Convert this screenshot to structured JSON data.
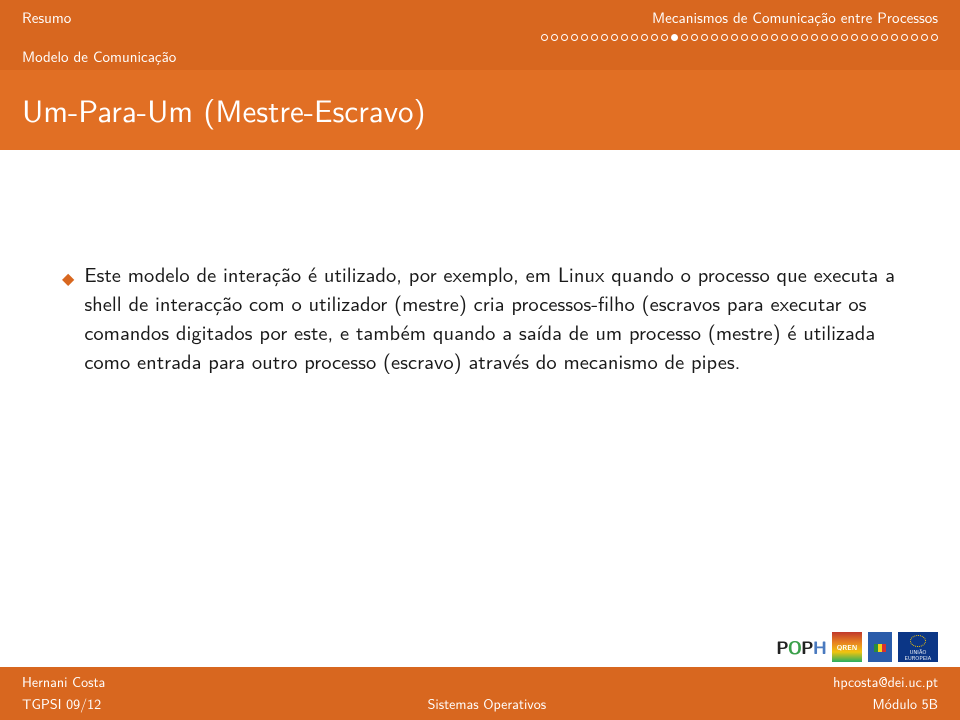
{
  "header": {
    "nav_left": "Resumo",
    "nav_right": "Mecanismos de Comunicação entre Processos",
    "subsection": "Modelo de Comunicação",
    "progress": {
      "total": 40,
      "current": 14
    }
  },
  "title": "Um-Para-Um (Mestre-Escravo)",
  "body": {
    "bullet1": "Este modelo de interação é utilizado, por exemplo, em Linux quando o processo que executa a shell de interacção com o utilizador (mestre) cria processos-filho (escravos para executar os comandos digitados por este, e também quando a saída de um processo (mestre) é utilizada como entrada para outro processo (escravo) através do mecanismo de pipes."
  },
  "footer": {
    "author": "Hernani Costa",
    "email": "hpcosta@dei.uc.pt",
    "course": "TGPSI 09/12",
    "center": "Sistemas Operativos",
    "module": "Módulo 5B"
  },
  "logos": {
    "poph": "POPH",
    "qren": "QREN",
    "eu": "UNIÃO EUROPEIA"
  }
}
